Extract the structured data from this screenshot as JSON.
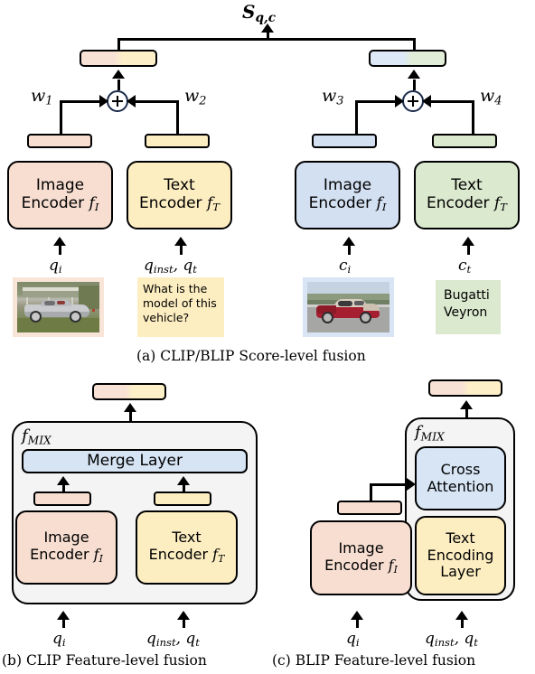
{
  "figure": {
    "panel_a": {
      "score_label": "S",
      "score_sub": "q,c",
      "weights": [
        "w",
        "w",
        "w",
        "w"
      ],
      "weight_indices": [
        "1",
        "2",
        "3",
        "4"
      ],
      "query_image_encoder": "Image\nEncoder",
      "query_image_encoder_line1": "Image",
      "query_image_encoder_line2": "Encoder",
      "query_image_encoder_sym": "f",
      "query_image_encoder_sym_sub": "I",
      "query_text_encoder_line1": "Text",
      "query_text_encoder_line2": "Encoder",
      "query_text_encoder_sym": "f",
      "query_text_encoder_sym_sub": "T",
      "cand_image_encoder_line1": "Image",
      "cand_image_encoder_line2": "Encoder",
      "cand_text_encoder_line1": "Text",
      "cand_text_encoder_line2": "Encoder",
      "input_qi": "q",
      "input_qi_sub": "i",
      "input_qinst": "q",
      "input_qinst_sub": "inst",
      "input_qt": "q",
      "input_qt_sub": "t",
      "input_ci": "c",
      "input_ci_sub": "i",
      "input_ct": "c",
      "input_ct_sub": "t",
      "question_text": "What is the model of this vehicle?",
      "candidate_text": "Bugatti Veyron",
      "caption": "(a) CLIP/BLIP Score-level fusion"
    },
    "panel_b": {
      "fmix_label": "f",
      "fmix_label_sub": "MIX",
      "merge_layer": "Merge Layer",
      "image_encoder_line1": "Image",
      "image_encoder_line2": "Encoder",
      "image_encoder_sym": "f",
      "image_encoder_sym_sub": "I",
      "text_encoder_line1": "Text",
      "text_encoder_line2": "Encoder",
      "text_encoder_sym": "f",
      "text_encoder_sym_sub": "T",
      "input_qi": "q",
      "input_qi_sub": "i",
      "input_qinst": "q",
      "input_qinst_sub": "inst",
      "input_qt": "q",
      "input_qt_sub": "t",
      "caption": "(b) CLIP Feature-level fusion"
    },
    "panel_c": {
      "fmix_label": "f",
      "fmix_label_sub": "MIX",
      "cross_attention_line1": "Cross",
      "cross_attention_line2": "Attention",
      "image_encoder_line1": "Image",
      "image_encoder_line2": "Encoder",
      "image_encoder_sym": "f",
      "image_encoder_sym_sub": "I",
      "text_encoding_line1": "Text",
      "text_encoding_line2": "Encoding",
      "text_encoding_line3": "Layer",
      "input_qi": "q",
      "input_qi_sub": "i",
      "input_qinst": "q",
      "input_qinst_sub": "inst",
      "input_qt": "q",
      "input_qt_sub": "t",
      "caption": "(c) BLIP Feature-level fusion"
    },
    "colors": {
      "image_salmon": "#f7ded1",
      "text_yellow": "#fdeec2",
      "image_blue": "#d3e0f2",
      "text_green": "#dbe9cf",
      "merge_blue": "#d6e4f4",
      "fmix_grey": "#f4f4f4",
      "outline": "#000000"
    }
  }
}
